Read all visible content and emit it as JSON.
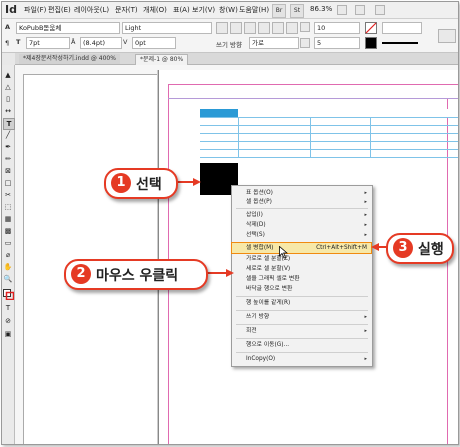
{
  "app": {
    "logo": "Id"
  },
  "menubar": {
    "items": [
      "파일(F)",
      "편집(E)",
      "레이아웃(L)",
      "문자(T)",
      "개체(O)",
      "표(A)",
      "보기(V)",
      "창(W)",
      "도움말(H)"
    ],
    "buttons": [
      "Br",
      "St"
    ],
    "zoom": "86.3%"
  },
  "control": {
    "font_family": "KoPubB돋움체",
    "font_style": "Light",
    "font_size": "7pt",
    "leading": "(8.4pt)",
    "tracking": "0pt",
    "field_a": "10",
    "field_b": "5",
    "label_vert": "쓰기 방향",
    "value_vert": "가로"
  },
  "tabs": [
    "*제4장문서작성하기.indd @ 400%",
    "*문제-1 @ 80%"
  ],
  "table": {
    "header_color": "#2a9ad6",
    "line_color": "#7fc3e8"
  },
  "context_menu": {
    "items": [
      {
        "label": "표 옵션(O)",
        "arrow": "▸"
      },
      {
        "label": "셀 옵션(P)",
        "arrow": "▸"
      },
      {
        "label": "삽입(I)",
        "arrow": "▸"
      },
      {
        "label": "삭제(D)",
        "arrow": "▸"
      },
      {
        "label": "선택(S)",
        "arrow": "▸"
      },
      {
        "label": "셀 병합(M)",
        "shortcut": "Ctrl+Alt+Shift+M"
      },
      {
        "label": "가로로 셀 분할(Z)"
      },
      {
        "label": "세로로 셀 분할(V)"
      },
      {
        "label": "셀을 그래픽 셀로 변환"
      },
      {
        "label": "바닥글 행으로 변환"
      },
      {
        "label": "행 높이를 같게(R)"
      },
      {
        "label": "쓰기 방향",
        "arrow": "▸"
      },
      {
        "label": "회전",
        "arrow": "▸"
      },
      {
        "label": "행으로 이동(G)..."
      },
      {
        "label": "InCopy(O)",
        "arrow": "▸"
      }
    ]
  },
  "callouts": [
    {
      "num": "1",
      "text": "선택"
    },
    {
      "num": "2",
      "text": "마우스 우클릭"
    },
    {
      "num": "3",
      "text": "실행"
    }
  ],
  "colors": {
    "callout": "#e53a24",
    "highlight_fill": "#f7e8a8",
    "highlight_border": "#f08a10"
  }
}
